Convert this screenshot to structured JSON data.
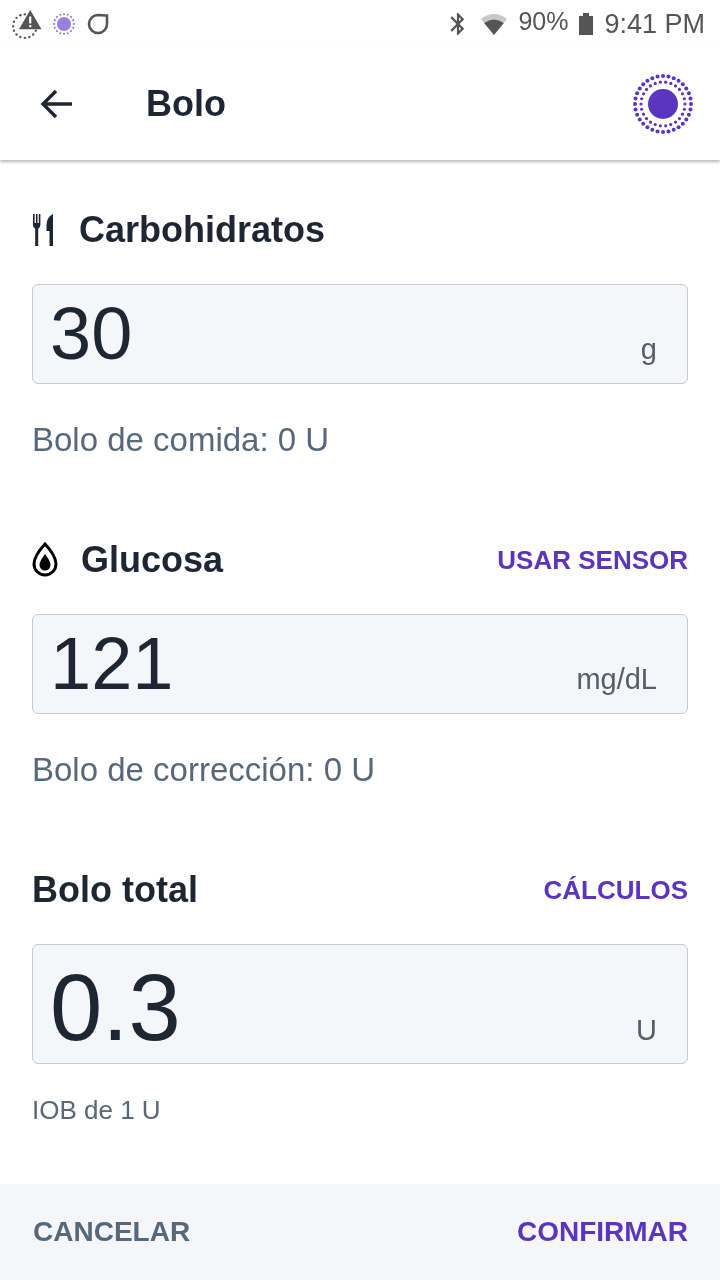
{
  "status_bar": {
    "battery": "90%",
    "time": "9:41 PM"
  },
  "app_bar": {
    "title": "Bolo"
  },
  "sections": [
    {
      "kind": "carbs",
      "label": "Carbohidratos",
      "value": "30",
      "unit": "g",
      "note": "Bolo de comida: 0 U"
    },
    {
      "kind": "glucose",
      "label": "Glucosa",
      "action": "USAR SENSOR",
      "value": "121",
      "unit": "mg/dL",
      "note": "Bolo de corrección: 0 U"
    },
    {
      "kind": "total",
      "label": "Bolo total",
      "action": "CÁLCULOS",
      "value": "0.3",
      "unit": "U",
      "note": "IOB de 1 U"
    }
  ],
  "footer": {
    "cancel": "CANCELAR",
    "confirm": "CONFIRMAR"
  }
}
